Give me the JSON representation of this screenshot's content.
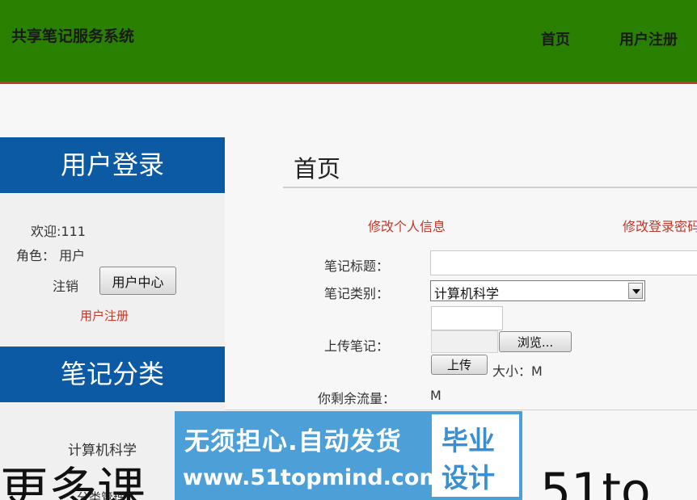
{
  "header": {
    "site_title": "共享笔记服务系统",
    "nav": [
      "首页",
      "用户注册"
    ]
  },
  "sidebar": {
    "login_title": "用户登录",
    "welcome": "欢迎:111",
    "role": "角色：  用户",
    "logout": "注销",
    "user_center": "用户中心",
    "register": "用户注册",
    "category_title": "笔记分类",
    "categories": [
      "计算机科学"
    ],
    "manage_fragment": "分类管理"
  },
  "main": {
    "title": "首页",
    "edit_info": "修改个人信息",
    "edit_password": "修改登录密码",
    "form": {
      "title_label": "笔记标题：",
      "title_value": "",
      "category_label": "笔记类别：",
      "category_value": "计算机科学",
      "upload_label": "上传笔记：",
      "browse": "浏览...",
      "upload": "上传",
      "size": "大小：M",
      "flow_label": "你剩余流量：",
      "flow_value": "M"
    }
  },
  "watermark": {
    "line1": "无须担心.自动发货",
    "line2": "www.51topmind.com",
    "badge1": "毕业",
    "badge2": "设计"
  },
  "overlay": {
    "big_left": "更多课",
    "big_right": "51to"
  },
  "colors": {
    "header_bg": "#2a8000",
    "header_border": "#c0392b",
    "panel_bg": "#0b5aa3",
    "link_red": "#c0392b"
  }
}
